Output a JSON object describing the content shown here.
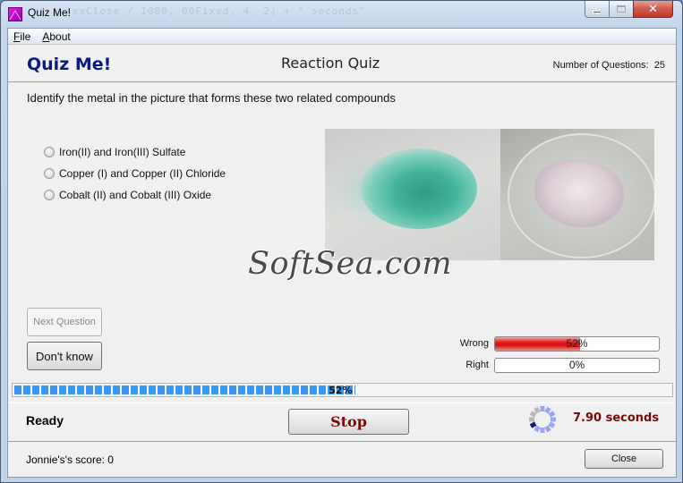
{
  "window": {
    "title": "Quiz Me!",
    "background_text": "xxClose / 1000, 00Fixed, 4, 2) + \" seconds\"",
    "controls": {
      "minimize": "minimize",
      "maximize": "maximize",
      "close": "✕"
    }
  },
  "menu": [
    {
      "accel": "F",
      "rest": "ile"
    },
    {
      "accel": "A",
      "rest": "bout"
    }
  ],
  "header": {
    "brand": "Quiz Me!",
    "quiz_name": "Reaction Quiz",
    "num_questions_label": "Number of Questions:",
    "num_questions": "25"
  },
  "question": {
    "text": "Identify the metal in the picture that forms these two related compounds",
    "options": [
      {
        "label": "Iron(II) and Iron(III) Sulfate",
        "selected": false
      },
      {
        "label": "Copper (I) and Copper (II) Chloride",
        "selected": false
      },
      {
        "label": "Cobalt (II) and Cobalt (III) Oxide",
        "selected": false
      }
    ],
    "image_description": [
      "green crystals",
      "pale pink powder in glass dish"
    ]
  },
  "watermark": "SoftSea.com",
  "buttons": {
    "next": "Next Question",
    "next_enabled": false,
    "dont_know": "Don't know",
    "stop": "Stop",
    "close": "Close"
  },
  "meters": {
    "wrong": {
      "label": "Wrong",
      "value": 52,
      "text": "52%",
      "color": "#e01818"
    },
    "right": {
      "label": "Right",
      "value": 0,
      "text": "0%",
      "color": "#e01818"
    }
  },
  "progress": {
    "value": 52,
    "text": "52%",
    "color": "#3a96f4"
  },
  "status": {
    "text": "Ready",
    "timer": "7.90 seconds",
    "score": "Jonnie's's score: 0"
  },
  "colors": {
    "brand": "#0a1a80",
    "stop": "#7a0a0a",
    "timer": "#7a0a0a",
    "spinner_active": "#0a1a80",
    "spinner_light": "#9aa4f0",
    "spinner_gray": "#b8b8b8"
  }
}
